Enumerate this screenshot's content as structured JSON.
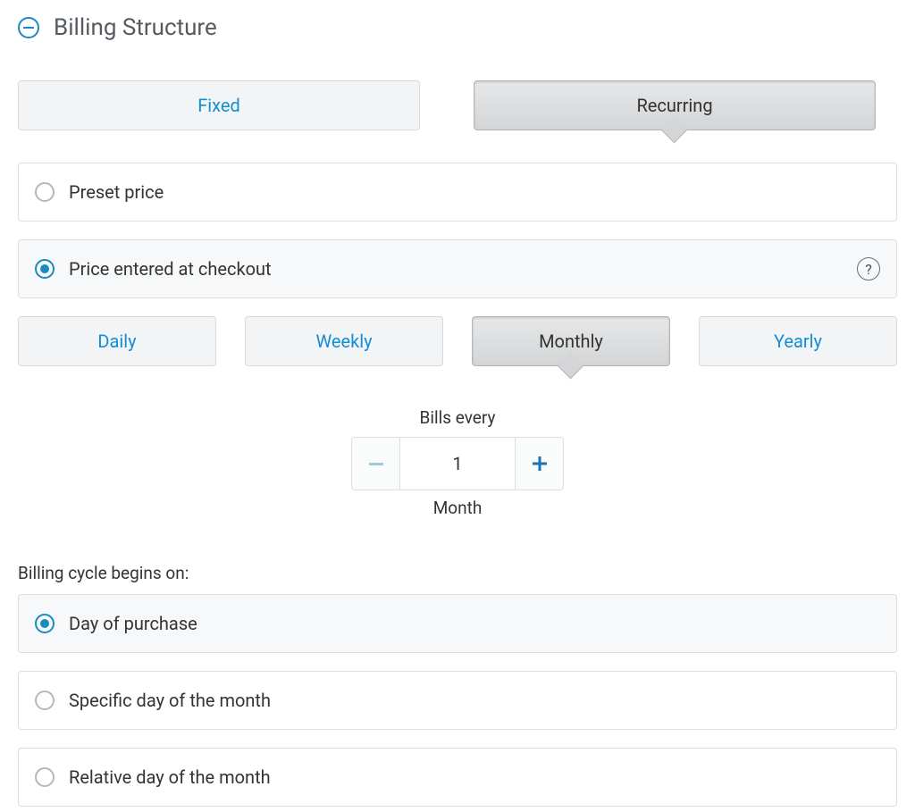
{
  "section": {
    "title": "Billing Structure"
  },
  "billing_type": {
    "options": [
      "Fixed",
      "Recurring"
    ],
    "selected": "Recurring"
  },
  "price_mode": {
    "options": [
      {
        "label": "Preset price",
        "has_help": false
      },
      {
        "label": "Price entered at checkout",
        "has_help": true
      }
    ],
    "selected": "Price entered at checkout"
  },
  "interval": {
    "options": [
      "Daily",
      "Weekly",
      "Monthly",
      "Yearly"
    ],
    "selected": "Monthly"
  },
  "bills_every": {
    "top_label": "Bills every",
    "value": "1",
    "unit_label": "Month"
  },
  "cycle_start": {
    "heading": "Billing cycle begins on:",
    "options": [
      "Day of purchase",
      "Specific day of the month",
      "Relative day of the month"
    ],
    "selected": "Day of purchase"
  },
  "colors": {
    "accent": "#1a8ac2",
    "link": "#128ed4"
  }
}
